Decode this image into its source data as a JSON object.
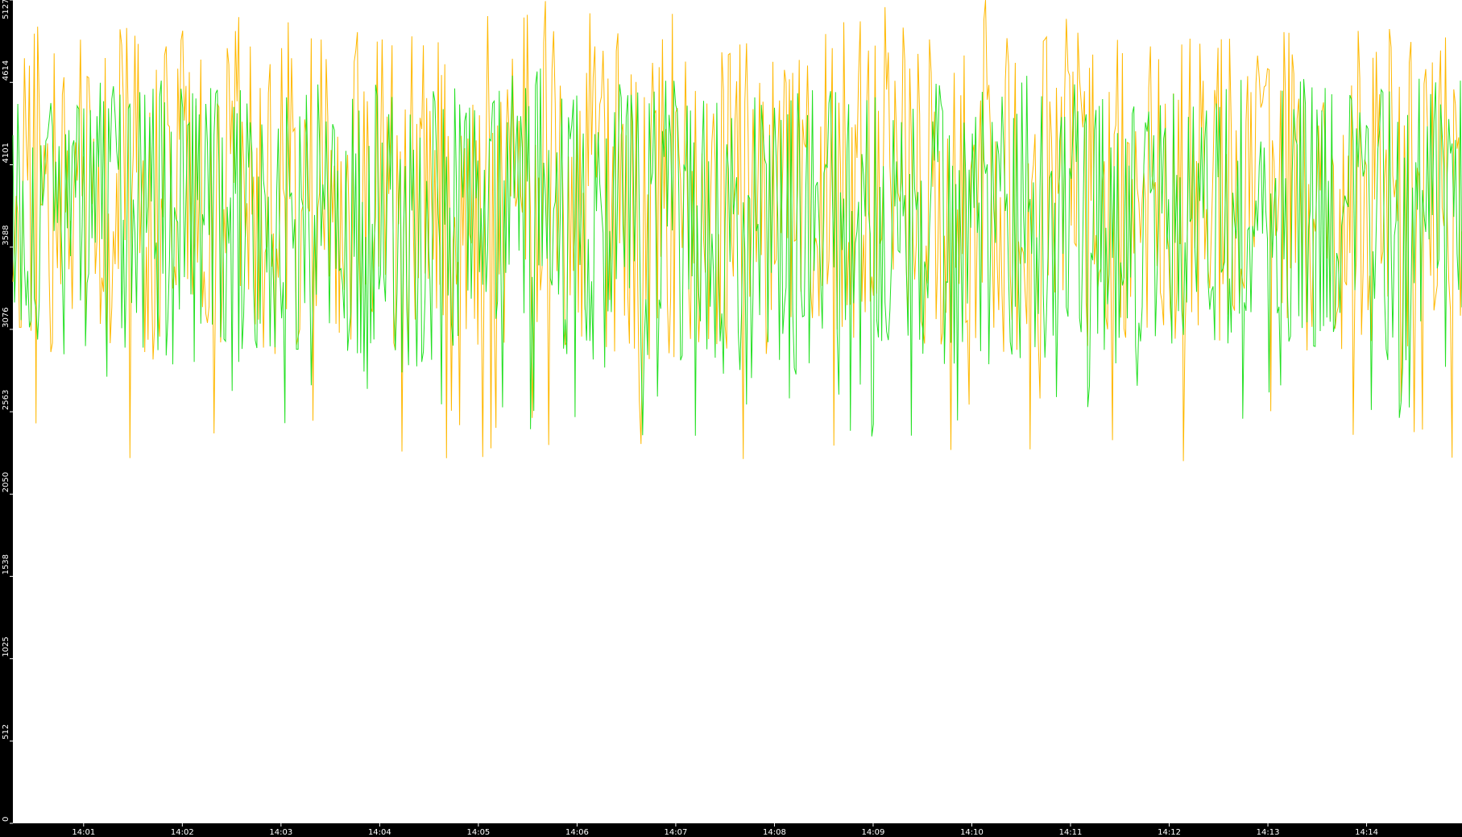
{
  "chart_data": {
    "type": "line",
    "title": "",
    "xlabel": "",
    "ylabel": "",
    "ylim": [
      0,
      5127
    ],
    "y_ticks": [
      "0",
      "512",
      "1025",
      "1538",
      "2050",
      "2563",
      "3076",
      "3588",
      "4101",
      "4614",
      "5127"
    ],
    "x_ticks": [
      "14:01",
      "14:02",
      "14:03",
      "14:04",
      "14:05",
      "14:06",
      "14:07",
      "14:08",
      "14:09",
      "14:10",
      "14:11",
      "14:12",
      "14:13",
      "14:14"
    ],
    "x_start": "14:00:17",
    "x_end": "14:14:58",
    "colors": {
      "background": "#000000",
      "plot_background": "#ffffff",
      "axis_text": "#ffffff",
      "series_orange": "#ffb800",
      "series_green": "#22e022"
    },
    "series": [
      {
        "color": "#ffb800",
        "typical_range": [
          2900,
          4900
        ],
        "mean": 3950,
        "peak_max": 5127,
        "trough_min": 2250
      },
      {
        "color": "#22e022",
        "typical_range": [
          2700,
          4500
        ],
        "mean": 3750,
        "peak_max": 4700,
        "trough_min": 2400
      }
    ],
    "grid": false,
    "legend": "none"
  }
}
